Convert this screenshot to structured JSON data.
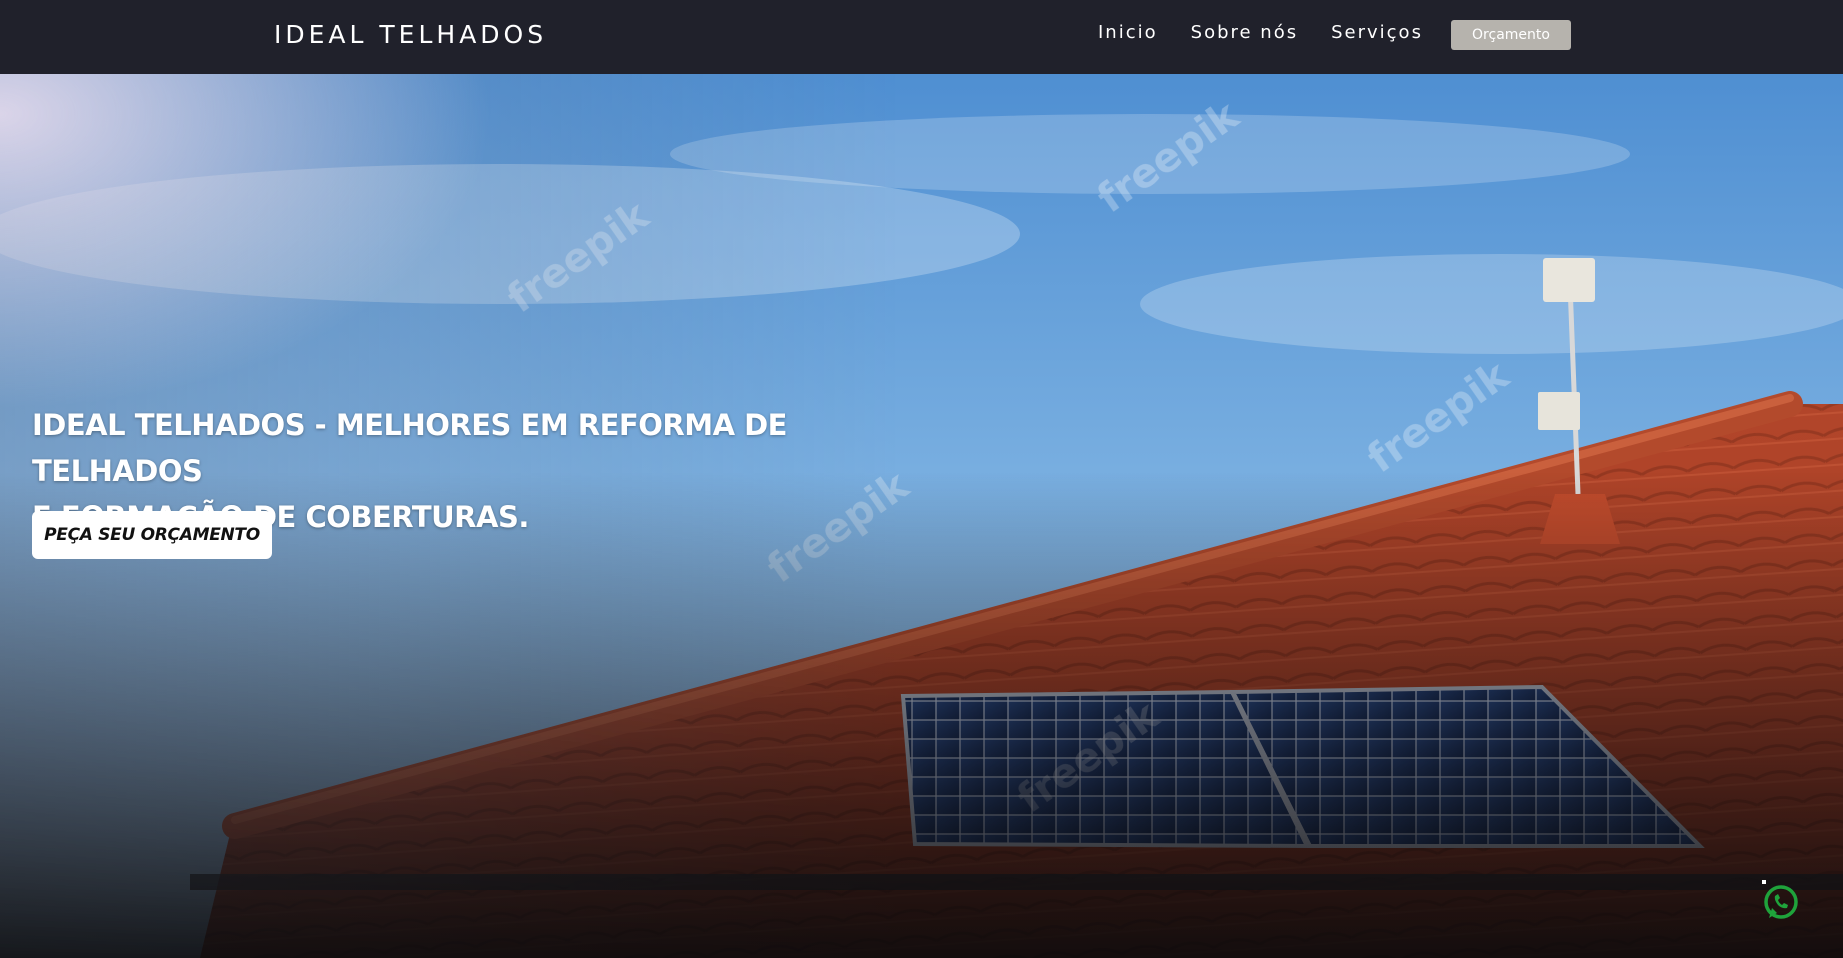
{
  "navbar": {
    "brand": "IDEAL TELHADOS",
    "links": [
      {
        "label": "Inicio"
      },
      {
        "label": "Sobre nós"
      },
      {
        "label": "Serviços"
      }
    ],
    "quote_button": "Orçamento",
    "background_color": "#20212b"
  },
  "hero": {
    "title_line1": "IDEAL TELHADOS - MELHORES EM REFORMA DE TELHADOS",
    "title_line2": "E FORMAÇÃO DE COBERTURAS.",
    "cta_label": "PEÇA SEU ORÇAMENTO",
    "image_watermark": "freepik"
  },
  "floating": {
    "whatsapp_icon": "whatsapp-icon",
    "whatsapp_color": "#1fa33b"
  },
  "colors": {
    "roof_tile": "#b5452a",
    "sky": "#6ea8dd",
    "solar_panel": "#1f3a6b"
  }
}
